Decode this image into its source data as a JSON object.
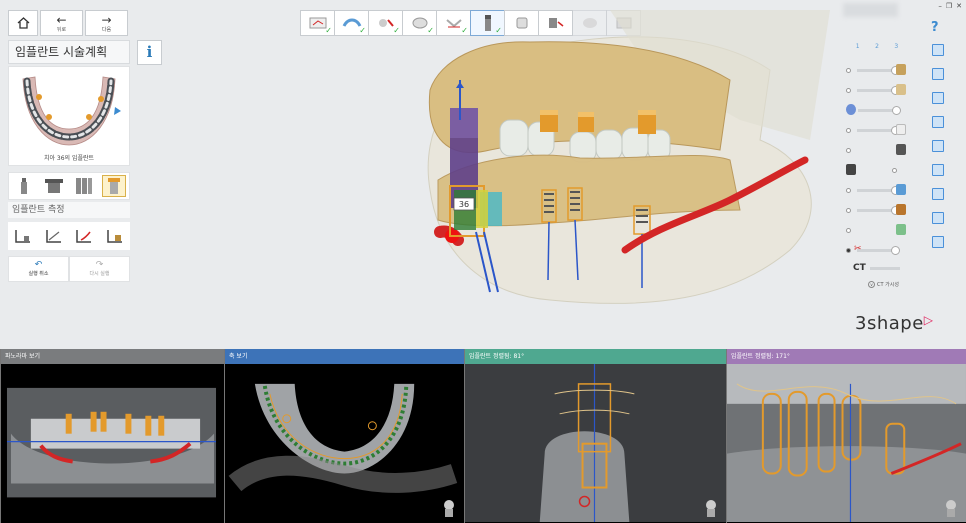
{
  "nav": {
    "home_icon": "home-icon",
    "back_label": "뒤로",
    "next_label": "다음"
  },
  "panel": {
    "title": "임플란트 시술계획",
    "caption": "치아 36의 임플란트",
    "measure_label": "임플란트 측정",
    "undo_label": "실행 취소",
    "redo_label": "다시 실행"
  },
  "workflow": {
    "steps": [
      "scan-prep",
      "align",
      "tooth-select",
      "crown-design",
      "nerve",
      "implant-place",
      "abutment",
      "guide-plan",
      "sleeve",
      "export"
    ],
    "completed_count": 6,
    "current_index": 5
  },
  "right_panel": {
    "tabs": [
      "1",
      "2",
      "3"
    ],
    "ct_label": "CT",
    "ct_visible_label": "CT 가시성",
    "brand": "3shape"
  },
  "implant": {
    "badge": "36"
  },
  "bottom": {
    "panes": [
      {
        "title": "파노라마 보기",
        "color": "#7a7c7e"
      },
      {
        "title": "축 보기",
        "color": "#3d73b8"
      },
      {
        "title": "임플란트 정렬됨: 81°",
        "color": "#4fa890"
      },
      {
        "title": "임플란트 정렬됨: 171°",
        "color": "#a07ab6"
      }
    ]
  },
  "colors": {
    "accent_blue": "#3c8bd0",
    "check_green": "#2eae3d",
    "brand_accent": "#e0245e",
    "nerve_red": "#d32626",
    "implant_orange": "#e39a2c",
    "implant_purple": "#5e3f8a"
  }
}
